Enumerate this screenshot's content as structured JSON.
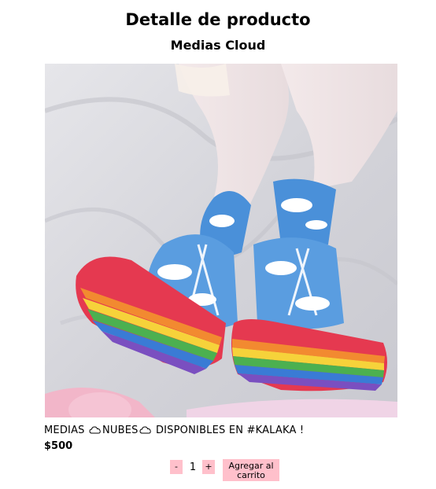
{
  "page": {
    "title": "Detalle de producto"
  },
  "product": {
    "name": "Medias Cloud",
    "image_icon": "product-photo",
    "description_part1": "MEDIAS",
    "description_part2": "NUBES",
    "description_part3": "DISPONIBLES EN #KALAKA !",
    "price": "$500"
  },
  "cart": {
    "minus_label": "-",
    "quantity": "1",
    "plus_label": "+",
    "add_label": "Agregar al carrito"
  },
  "colors": {
    "button_bg": "#ffc0cb"
  }
}
